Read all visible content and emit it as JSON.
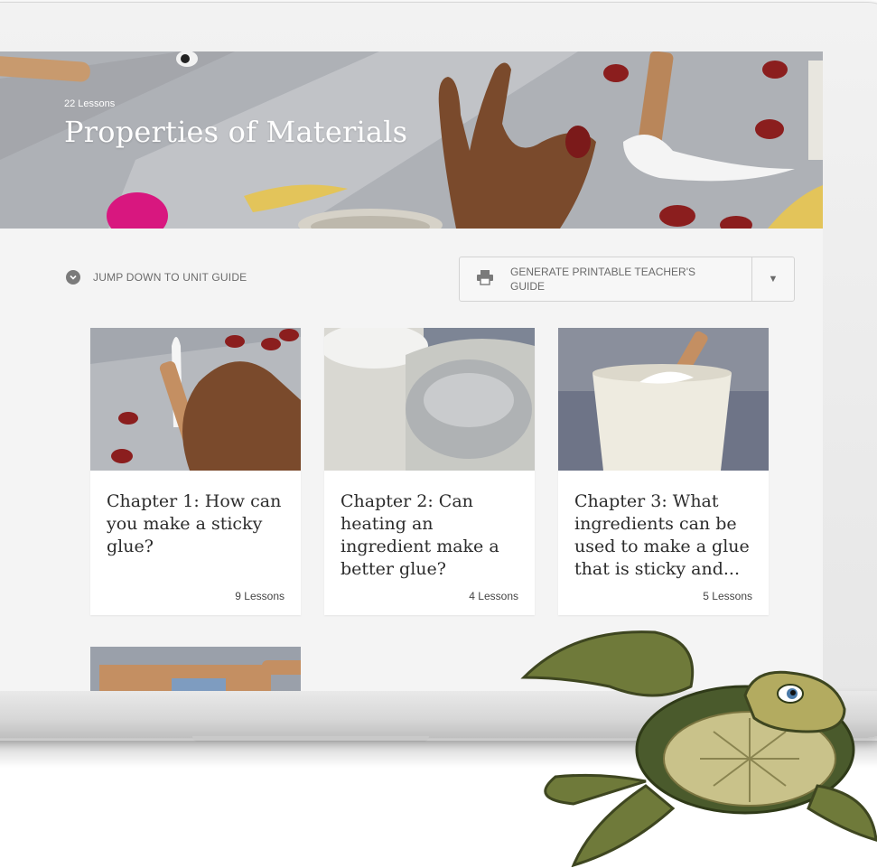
{
  "hero": {
    "lesson_count": "22 Lessons",
    "title": "Properties of Materials"
  },
  "toolbar": {
    "jump_label": "JUMP DOWN TO UNIT GUIDE",
    "generate_label": "GENERATE PRINTABLE TEACHER'S GUIDE"
  },
  "chapters": [
    {
      "title": "Chapter 1: How can you make a sticky glue?",
      "lessons": "9 Lessons"
    },
    {
      "title": "Chapter 2: Can heating an ingredient make a better glue?",
      "lessons": "4 Lessons"
    },
    {
      "title": "Chapter 3: What ingredients can be used to make a glue that is sticky and...",
      "lessons": "5 Lessons"
    }
  ],
  "colors": {
    "screen_bg": "#f4f4f4",
    "text_dark": "#2c2c2c",
    "text_muted": "#6b6b6b",
    "bean_red": "#8b1e1e",
    "wood": "#b9865a",
    "skin": "#7a4a2c"
  },
  "icons": [
    "chevron-down-circle-icon",
    "printer-icon",
    "caret-down-icon"
  ]
}
